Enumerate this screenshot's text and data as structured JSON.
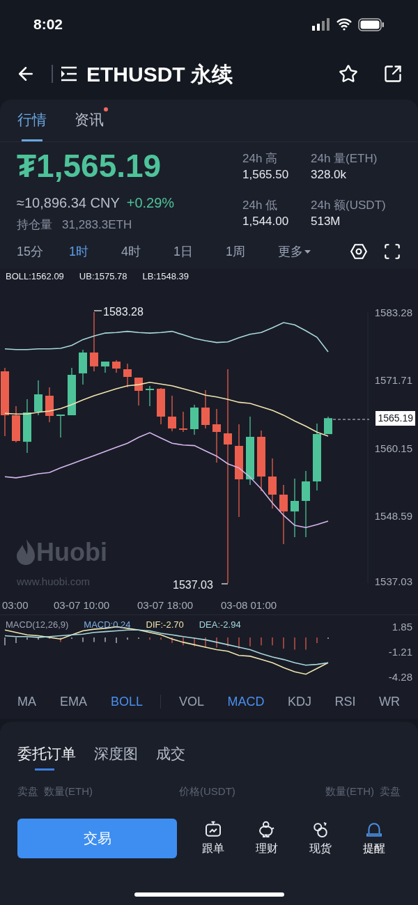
{
  "status_bar": {
    "time": "8:02"
  },
  "header": {
    "title": "ETHUSDT 永续"
  },
  "tabs": [
    {
      "label": "行情",
      "selected": true,
      "dot": false
    },
    {
      "label": "资讯",
      "selected": false,
      "dot": true
    }
  ],
  "ticker": {
    "price": "₮1,565.19",
    "cny": "≈10,896.34 CNY",
    "change": "+0.29%",
    "open_interest_label": "持仓量",
    "open_interest": "31,283.3ETH",
    "stats": [
      {
        "label": "24h 高",
        "value": "1,565.50"
      },
      {
        "label": "24h 量(ETH)",
        "value": "328.0k"
      },
      {
        "label": "24h 低",
        "value": "1,544.00"
      },
      {
        "label": "24h 额(USDT)",
        "value": "513M"
      }
    ]
  },
  "intervals": [
    {
      "label": "15分",
      "selected": false,
      "kind": "plain"
    },
    {
      "label": "1时",
      "selected": true,
      "kind": "plain"
    },
    {
      "label": "4时",
      "selected": false,
      "kind": "plain"
    },
    {
      "label": "1日",
      "selected": false,
      "kind": "plain"
    },
    {
      "label": "1周",
      "selected": false,
      "kind": "plain"
    },
    {
      "label": "更多",
      "selected": false,
      "kind": "dropdown"
    }
  ],
  "chart": {
    "high_label": "1583.28",
    "low_label": "1537.03",
    "last_price": "1565.19",
    "x_labels": [
      "03:00",
      "03-07 10:00",
      "03-07 18:00",
      "03-08 01:00"
    ],
    "watermark": {
      "brand": "Huobi",
      "url": "www.huobi.com"
    },
    "chart_data": {
      "type": "candlestick",
      "ylim": [
        1537.03,
        1583.28
      ],
      "yticks": [
        {
          "value": 1583.28,
          "label": "1583.28"
        },
        {
          "value": 1571.71,
          "label": "1571.71"
        },
        {
          "value": 1560.15,
          "label": "1560.15"
        },
        {
          "value": 1548.59,
          "label": "1548.59"
        },
        {
          "value": 1537.03,
          "label": "1537.03"
        }
      ],
      "ohlc": [
        [
          1573.17,
          1573.77,
          1562.12,
          1565.68
        ],
        [
          1565.68,
          1567.23,
          1561.05,
          1561.28
        ],
        [
          1561.16,
          1568.42,
          1559.26,
          1566.16
        ],
        [
          1566.28,
          1571.63,
          1565.68,
          1569.25
        ],
        [
          1569.01,
          1570.44,
          1564.49,
          1565.56
        ],
        [
          1565.56,
          1565.8,
          1561.88,
          1565.8
        ],
        [
          1565.68,
          1573.77,
          1565.68,
          1572.58
        ],
        [
          1572.82,
          1576.86,
          1570.91,
          1576.38
        ],
        [
          1576.38,
          1583.28,
          1573.17,
          1574.01
        ],
        [
          1574.01,
          1574.84,
          1572.94,
          1574.84
        ],
        [
          1574.84,
          1575.08,
          1572.94,
          1573.65
        ],
        [
          1573.53,
          1574.48,
          1570.44,
          1572.22
        ],
        [
          1572.1,
          1572.1,
          1567.35,
          1569.84
        ],
        [
          1569.96,
          1570.68,
          1567.23,
          1570.2
        ],
        [
          1570.2,
          1570.32,
          1564.14,
          1565.44
        ],
        [
          1565.44,
          1569.01,
          1562.95,
          1563.42
        ],
        [
          1563.42,
          1566.28,
          1562.83,
          1563.19
        ],
        [
          1563.3,
          1567.47,
          1562.35,
          1566.99
        ],
        [
          1566.99,
          1569.96,
          1563.42,
          1564.02
        ],
        [
          1564.14,
          1566.75,
          1557.6,
          1562.83
        ],
        [
          1562.59,
          1573.53,
          1537.03,
          1560.69
        ],
        [
          1560.45,
          1564.14,
          1548.32,
          1554.74
        ],
        [
          1554.74,
          1565.44,
          1553.79,
          1562.0
        ],
        [
          1562.0,
          1563.07,
          1552.72,
          1555.22
        ],
        [
          1555.22,
          1558.31,
          1549.75,
          1552.13
        ],
        [
          1552.13,
          1553.79,
          1543.69,
          1549.27
        ],
        [
          1549.27,
          1554.86,
          1544.88,
          1551.06
        ],
        [
          1551.06,
          1556.17,
          1544.88,
          1554.39
        ],
        [
          1554.39,
          1564.26,
          1552.84,
          1562.47
        ],
        [
          1562.47,
          1565.44,
          1562.47,
          1565.19
        ]
      ],
      "series": [
        {
          "name": "BOLL:1562.09",
          "type": "line",
          "color": "#f1e4b0",
          "values": [
            1566.0,
            1565.9,
            1565.9,
            1566.2,
            1566.4,
            1566.8,
            1567.5,
            1568.3,
            1569.0,
            1569.6,
            1570.2,
            1570.7,
            1570.9,
            1571.3,
            1571.0,
            1570.7,
            1570.2,
            1569.7,
            1569.1,
            1568.8,
            1568.4,
            1567.9,
            1567.7,
            1567.1,
            1566.5,
            1565.7,
            1564.7,
            1563.8,
            1562.8,
            1562.1
          ]
        },
        {
          "name": "UB:1575.78",
          "type": "line",
          "color": "#a9d8df",
          "values": [
            1577.0,
            1576.9,
            1576.9,
            1577.0,
            1577.0,
            1577.1,
            1577.6,
            1578.6,
            1579.2,
            1579.7,
            1579.8,
            1580.0,
            1579.8,
            1579.7,
            1579.8,
            1580.0,
            1579.4,
            1578.8,
            1578.4,
            1578.1,
            1578.2,
            1578.9,
            1579.5,
            1579.8,
            1580.6,
            1581.5,
            1581.1,
            1580.1,
            1579.0,
            1576.5
          ]
        },
        {
          "name": "LB:1548.39",
          "type": "line",
          "color": "#d7b7f0",
          "values": [
            1555.2,
            1555.0,
            1555.3,
            1555.7,
            1555.9,
            1556.7,
            1557.4,
            1558.1,
            1558.8,
            1559.5,
            1560.2,
            1560.9,
            1561.9,
            1562.7,
            1561.8,
            1560.9,
            1560.6,
            1560.5,
            1559.6,
            1558.7,
            1557.4,
            1556.7,
            1555.1,
            1553.1,
            1550.7,
            1548.6,
            1546.9,
            1546.5,
            1547.0,
            1547.6
          ]
        }
      ]
    }
  },
  "macd": {
    "labels": [
      {
        "text": "MACD(12,26,9)",
        "color": "#9aa3b5"
      },
      {
        "text": "MACD:0.24",
        "color": "#7fb0e8"
      }
    ],
    "chart_data": {
      "type": "line",
      "ylim": [
        -4.28,
        1.85
      ],
      "yticks": [
        {
          "value": 1.85,
          "label": "1.85"
        },
        {
          "value": -1.21,
          "label": "-1.21"
        },
        {
          "value": -4.28,
          "label": "-4.28"
        }
      ],
      "series": [
        {
          "name": "DIF:-2.70",
          "color": "#f0e6b0",
          "values": [
            1.4,
            1.1,
            0.8,
            0.7,
            0.5,
            0.3,
            0.8,
            1.3,
            1.5,
            1.6,
            1.8,
            1.6,
            1.4,
            1.1,
            0.8,
            0.3,
            -0.1,
            -0.4,
            -0.7,
            -1.0,
            -1.2,
            -1.7,
            -1.8,
            -2.2,
            -2.6,
            -3.2,
            -3.7,
            -4.0,
            -3.3,
            -2.6
          ]
        },
        {
          "name": "DEA:-2.94",
          "color": "#a8d8e0",
          "values": [
            0.7,
            0.6,
            0.6,
            0.5,
            0.6,
            0.7,
            0.8,
            0.9,
            1.1,
            1.2,
            1.3,
            1.4,
            1.4,
            1.3,
            1.0,
            0.8,
            0.6,
            0.4,
            0.2,
            -0.1,
            -0.4,
            -0.7,
            -1.0,
            -1.5,
            -1.9,
            -2.2,
            -2.6,
            -2.9,
            -2.8,
            -2.6
          ]
        }
      ]
    }
  },
  "main_indicators": [
    {
      "label": "MA",
      "selected": false
    },
    {
      "label": "EMA",
      "selected": false
    },
    {
      "label": "BOLL",
      "selected": true
    }
  ],
  "sub_indicators": [
    {
      "label": "VOL",
      "selected": false
    },
    {
      "label": "MACD",
      "selected": true
    },
    {
      "label": "KDJ",
      "selected": false
    },
    {
      "label": "RSI",
      "selected": false
    },
    {
      "label": "WR",
      "selected": false
    }
  ],
  "order_tabs": [
    {
      "label": "委托订单",
      "selected": true
    },
    {
      "label": "深度图",
      "selected": false
    },
    {
      "label": "成交",
      "selected": false
    }
  ],
  "order_header": [
    "卖盘",
    "数量(ETH)",
    "价格(USDT)",
    "数量(ETH)",
    "卖盘"
  ],
  "trade_button": "交易",
  "nav": [
    {
      "label": "跟单",
      "kind": "copy",
      "selected": false
    },
    {
      "label": "理财",
      "kind": "finance",
      "selected": false
    },
    {
      "label": "现货",
      "kind": "spot",
      "selected": false
    },
    {
      "label": "提醒",
      "kind": "alert",
      "selected": true
    }
  ]
}
